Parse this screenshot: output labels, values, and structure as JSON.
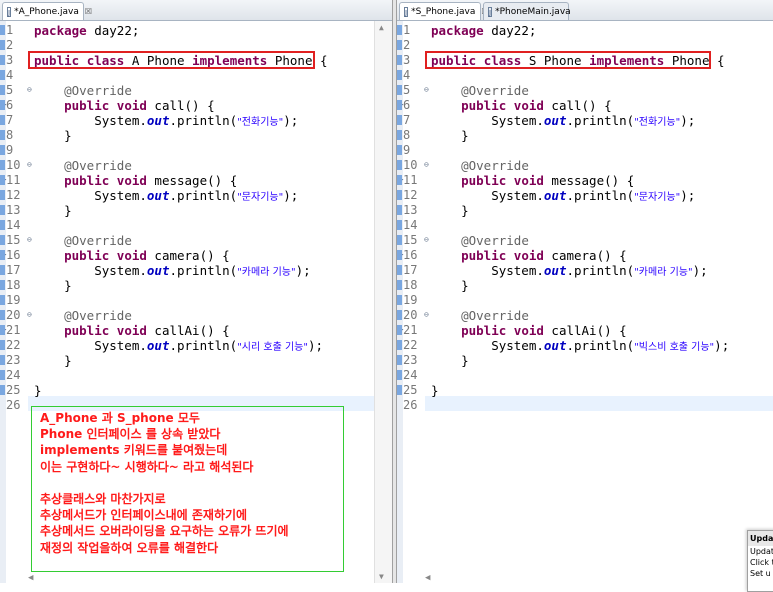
{
  "left": {
    "tab_label": "*A_Phone.java",
    "tab_close": "☒",
    "lines": [
      "package day22;",
      "",
      "public class A_Phone implements Phone {",
      "",
      "    @Override",
      "    public void call() {",
      "        System.out.println(\"전화기능\");",
      "    }",
      "",
      "    @Override",
      "    public void message() {",
      "        System.out.println(\"문자기능\");",
      "    }",
      "",
      "    @Override",
      "    public void camera() {",
      "        System.out.println(\"카메라 기능\");",
      "    }",
      "",
      "    @Override",
      "    public void callAi() {",
      "        System.out.println(\"시리 호출 기능\");",
      "    }",
      "",
      "}",
      ""
    ],
    "call_strings": [
      "전화기능",
      "문자기능",
      "카메라 기능",
      "시리 호출 기능"
    ],
    "class_name": "A_Phone"
  },
  "right": {
    "tabs": [
      {
        "label": "*S_Phone.java",
        "close": "☒",
        "active": true
      },
      {
        "label": "*PhoneMain.java",
        "active": false
      }
    ],
    "call_strings": [
      "전화기능",
      "문자기능",
      "카메라 기능",
      "빅스비 호출 기능"
    ],
    "class_name": "S_Phone"
  },
  "code": {
    "package": "package",
    "package_name": "day22;",
    "public": "public",
    "class": "class",
    "implements": "implements",
    "interface": "Phone",
    "brace_open": "{",
    "brace_close": "}",
    "annotation": "@Override",
    "void": "void",
    "methods": [
      "call()",
      "message()",
      "camera()",
      "callAi()"
    ],
    "system": "System.",
    "out": "out",
    "println": ".println(",
    "end": ");"
  },
  "line_numbers": [
    "1",
    "2",
    "3",
    "4",
    "5",
    "6",
    "7",
    "8",
    "9",
    "10",
    "11",
    "12",
    "13",
    "14",
    "15",
    "16",
    "17",
    "18",
    "19",
    "20",
    "21",
    "22",
    "23",
    "24",
    "25",
    "26"
  ],
  "note_lines": [
    "A_Phone 과 S_phone 모두",
    "Phone 인터페이스 를 상속 받았다",
    "implements 키워드를 붙여줬는데",
    "이는 구현하다~ 시행하다~ 라고 해석된다",
    "",
    "추상클래스와 마찬가지로",
    "추상메서드가 인터페이스내에 존재하기에",
    "추상메서드 오버라이딩을 요구하는 오류가 뜨기에",
    "재정의 작업을하여 오류를 해결한다"
  ],
  "popup": {
    "title": "Updat",
    "lines": [
      "Updat",
      "Click t",
      "Set u"
    ]
  },
  "colors": {
    "keyword": "#7f0055",
    "string": "#2a00ff",
    "field": "#0000c0",
    "annotation": "#646464",
    "highlight_box": "#e02020",
    "note_border": "#33cc33",
    "note_text": "#ff1a1a"
  }
}
